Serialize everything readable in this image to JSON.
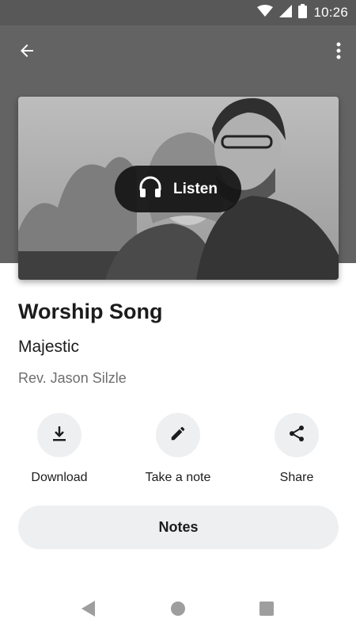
{
  "status_bar": {
    "time": "10:26",
    "icons": [
      "wifi-icon",
      "signal-icon",
      "battery-icon"
    ]
  },
  "app_bar": {
    "back_icon": "arrow-left-icon",
    "menu_icon": "more-vert-icon"
  },
  "hero": {
    "image": "photo of a smiling couple (black and white)",
    "listen_label": "Listen",
    "listen_icon": "headphones-icon"
  },
  "content": {
    "title": "Worship Song",
    "subtitle": "Majestic",
    "speaker": "Rev. Jason Silzle"
  },
  "actions": [
    {
      "label": "Download",
      "icon": "download-icon"
    },
    {
      "label": "Take a note",
      "icon": "pencil-icon"
    },
    {
      "label": "Share",
      "icon": "share-icon"
    }
  ],
  "notes_button": {
    "label": "Notes"
  },
  "nav_bar": {
    "icons": [
      "back-triangle-icon",
      "home-circle-icon",
      "recents-square-icon"
    ]
  },
  "colors": {
    "app_bar": "#636363",
    "status_bar": "#585858",
    "button_bg": "#eeeff1",
    "text": "#1c1c1c",
    "muted_text": "#6e6e6e"
  }
}
